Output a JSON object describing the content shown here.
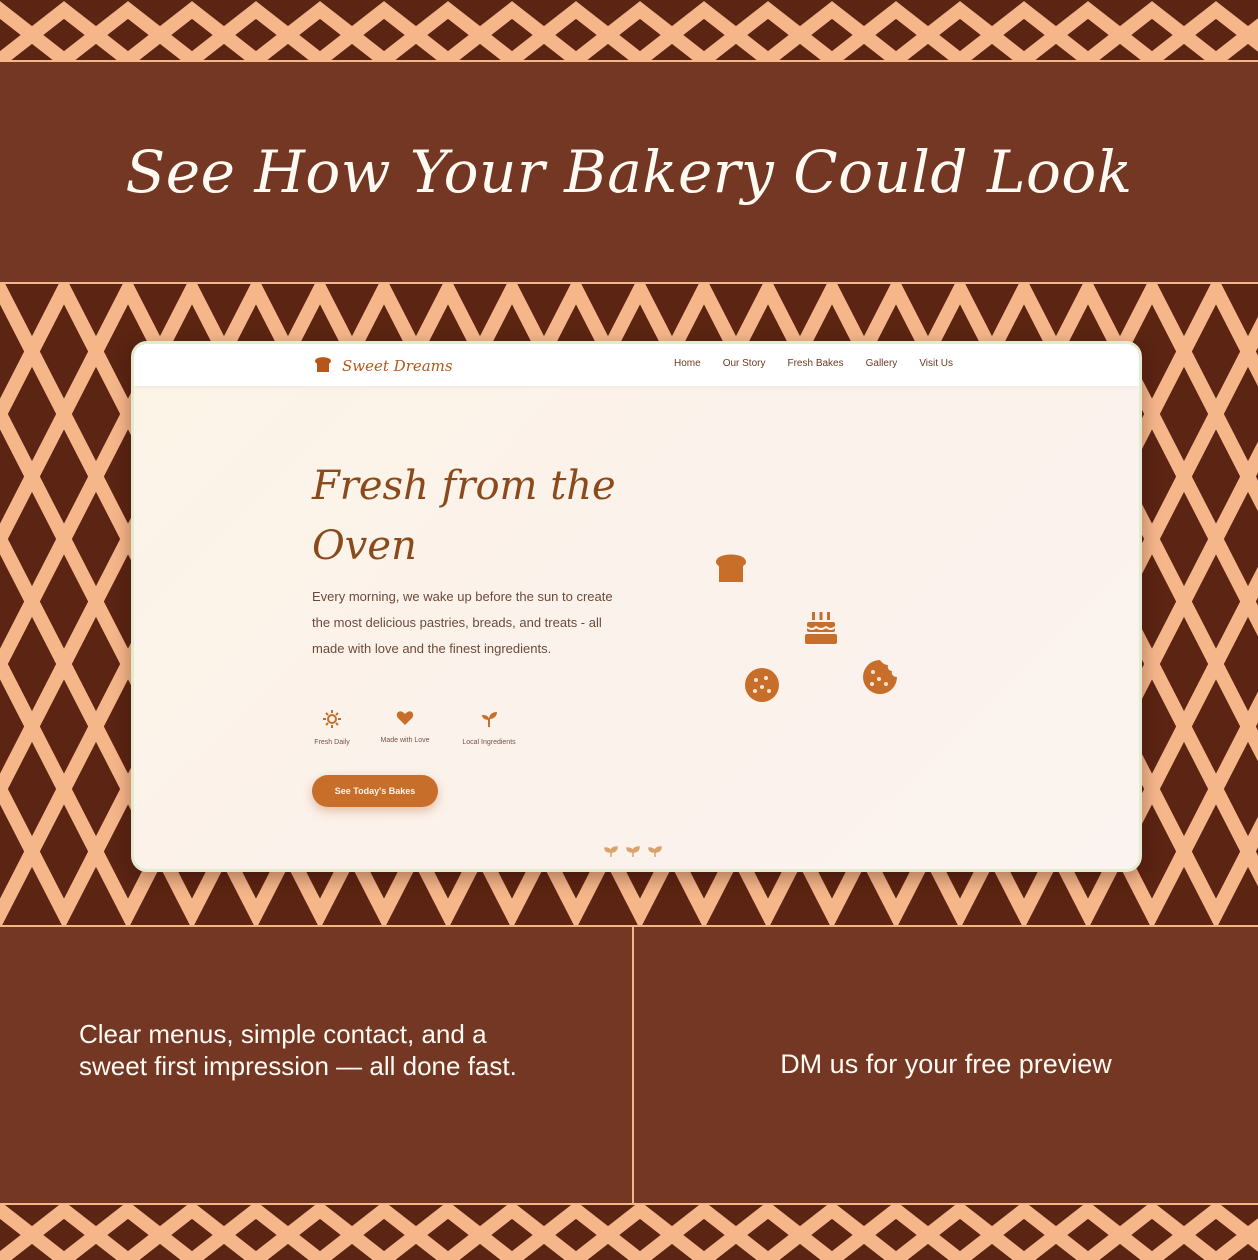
{
  "headline": "See How Your Bakery Could Look",
  "mock_site": {
    "brand": "Sweet Dreams",
    "nav": [
      "Home",
      "Our Story",
      "Fresh Bakes",
      "Gallery",
      "Visit Us"
    ],
    "hero_title_line1": "Fresh from the",
    "hero_title_line2": "Oven",
    "hero_text": "Every morning, we wake up before the sun to create the most delicious pastries, breads, and treats - all made with love and the finest ingredients.",
    "features": [
      {
        "icon": "sun-icon",
        "label": "Fresh Daily"
      },
      {
        "icon": "heart-icon",
        "label": "Made with Love"
      },
      {
        "icon": "sprout-icon",
        "label": "Local Ingredients"
      }
    ],
    "cta": "See Today's Bakes",
    "floating_icons": [
      "bread-icon",
      "cake-icon",
      "cookie-icon",
      "bitten-cookie-icon"
    ]
  },
  "bottom_left": "Clear menus, simple contact, and a sweet first impression — all done fast.",
  "bottom_right": "DM us for your free preview",
  "colors": {
    "background_brown": "#733724",
    "pattern_dark": "#5b2413",
    "pattern_light": "#f5b68a",
    "accent_orange": "#c86e2b"
  }
}
